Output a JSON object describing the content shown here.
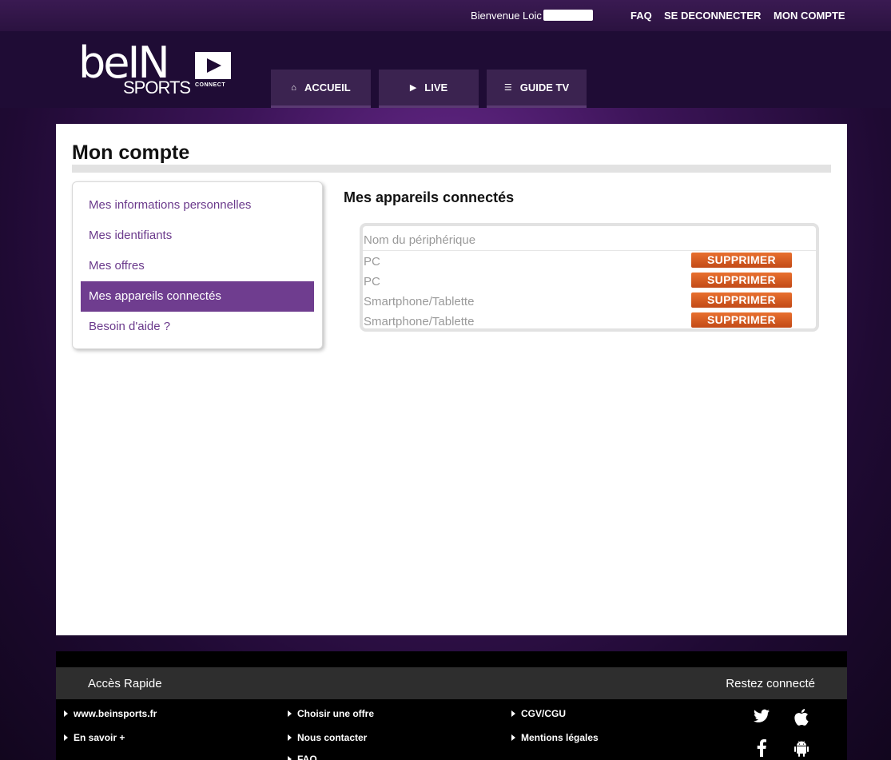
{
  "topbar": {
    "welcome": "Bienvenue Loic",
    "links": [
      "FAQ",
      "SE DECONNECTER",
      "MON COMPTE"
    ]
  },
  "logo": {
    "brand": "beIN",
    "sub": "SPORTS",
    "connect": "CONNECT"
  },
  "nav": {
    "tabs": [
      {
        "label": "ACCUEIL",
        "icon": "home-icon"
      },
      {
        "label": "LIVE",
        "icon": "play-icon"
      },
      {
        "label": "GUIDE TV",
        "icon": "list-icon"
      }
    ]
  },
  "page": {
    "title": "Mon compte"
  },
  "menu": {
    "items": [
      "Mes informations personnelles",
      "Mes identifiants",
      "Mes offres",
      "Mes appareils connectés",
      "Besoin d'aide ?"
    ],
    "active_index": 3
  },
  "devices": {
    "title": "Mes appareils connectés",
    "column_header": "Nom du périphérique",
    "rows": [
      {
        "name": "PC",
        "action": "SUPPRIMER"
      },
      {
        "name": "PC",
        "action": "SUPPRIMER"
      },
      {
        "name": "Smartphone/Tablette",
        "action": "SUPPRIMER"
      },
      {
        "name": "Smartphone/Tablette",
        "action": "SUPPRIMER"
      }
    ]
  },
  "footer": {
    "quick_access": "Accès Rapide",
    "stay_connected": "Restez connecté",
    "col1": [
      "www.beinsports.fr",
      "En savoir +"
    ],
    "col2": [
      "Choisir une offre",
      "Nous contacter",
      "FAQ"
    ],
    "col3": [
      "CGV/CGU",
      "Mentions légales"
    ],
    "social": [
      "twitter-icon",
      "apple-icon",
      "facebook-icon",
      "android-icon"
    ]
  },
  "colors": {
    "accent": "#6f3d8f",
    "button": "#d85a22",
    "header": "#1f0c35"
  }
}
